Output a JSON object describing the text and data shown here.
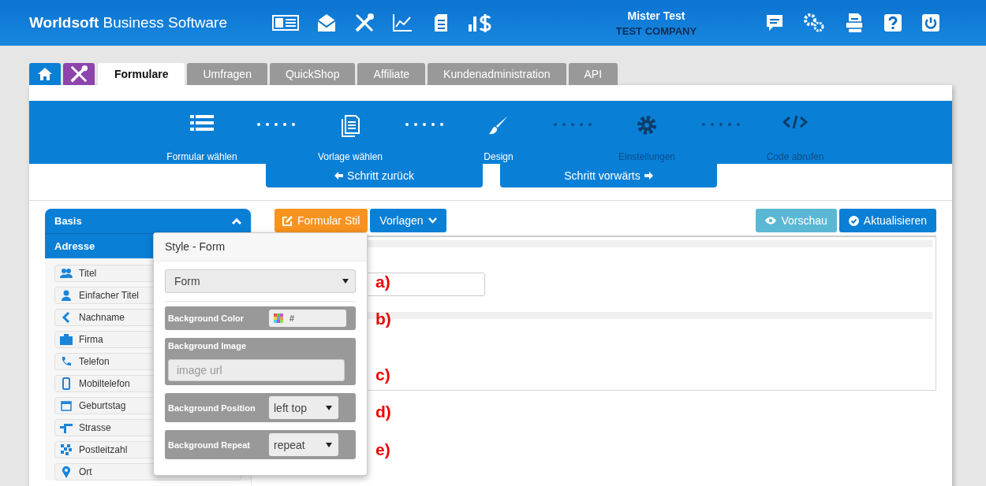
{
  "header": {
    "brand": "**Worldsoft** Business Software",
    "user": "Mister Test",
    "company": "TEST COMPANY"
  },
  "tabs": [
    {
      "label": "Formulare",
      "selected": true
    },
    {
      "label": "Umfragen",
      "selected": false
    },
    {
      "label": "QuickShop",
      "selected": false
    },
    {
      "label": "Affiliate",
      "selected": false
    },
    {
      "label": "Kundenadministration",
      "selected": false
    },
    {
      "label": "API",
      "selected": false
    }
  ],
  "steps": [
    {
      "label": "Formular wählen",
      "active": true
    },
    {
      "label": "Vorlage wählen",
      "active": true
    },
    {
      "label": "Design",
      "active": true
    },
    {
      "label": "Einstellungen",
      "active": false
    },
    {
      "label": "Code abrufen",
      "active": false
    }
  ],
  "step_buttons": {
    "back": "Schritt zurück",
    "forward": "Schritt vorwärts"
  },
  "sidebar": {
    "groups": [
      {
        "title": "Basis",
        "expanded": true
      },
      {
        "title": "Adresse"
      }
    ],
    "items": [
      "Titel",
      "Einfacher Titel",
      "Nachname",
      "Firma",
      "Telefon",
      "Mobiltelefon",
      "Geburtstag",
      "Strasse",
      "Postleitzahl",
      "Ort"
    ]
  },
  "toolbar": {
    "style": "Formular Stil",
    "templates": "Vorlagen",
    "preview": "Vorschau",
    "update": "Aktualisieren"
  },
  "popover": {
    "title": "Style - Form",
    "element_select": "Form",
    "rows": [
      {
        "kind": "color",
        "label": "Background Color",
        "value": "#"
      },
      {
        "kind": "image",
        "label": "Background Image",
        "placeholder": "image url"
      },
      {
        "kind": "select",
        "label": "Background Position",
        "value": "left top"
      },
      {
        "kind": "select",
        "label": "Background Repeat",
        "value": "repeat"
      }
    ]
  },
  "annotations": [
    "a)",
    "b)",
    "c)",
    "d)",
    "e)"
  ]
}
